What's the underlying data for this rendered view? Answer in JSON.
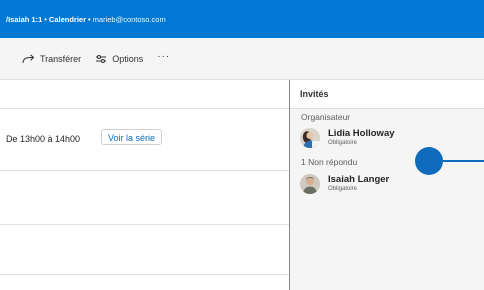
{
  "titlebar": {
    "event_name": "/Isaiah 1:1",
    "separator1": "•",
    "app": "Calendrier",
    "separator2": "•",
    "email": "marieb@contoso.com"
  },
  "toolbar": {
    "forward_label": "Transférer",
    "options_label": "Options",
    "more_label": "···"
  },
  "event": {
    "time_text": "De 13h00 à 14h00",
    "series_button_label": "Voir la série"
  },
  "attendees_pane": {
    "title": "Invités",
    "organizer_label": "Organisateur",
    "no_response_label": "1 Non répondu",
    "organizer": {
      "name": "Lidia Holloway",
      "role": "Obligatoire"
    },
    "pending": {
      "name": "Isaiah Langer",
      "role": "Obligatoire"
    }
  },
  "colors": {
    "brand": "#0078d4",
    "callout": "#0f6cbd"
  }
}
